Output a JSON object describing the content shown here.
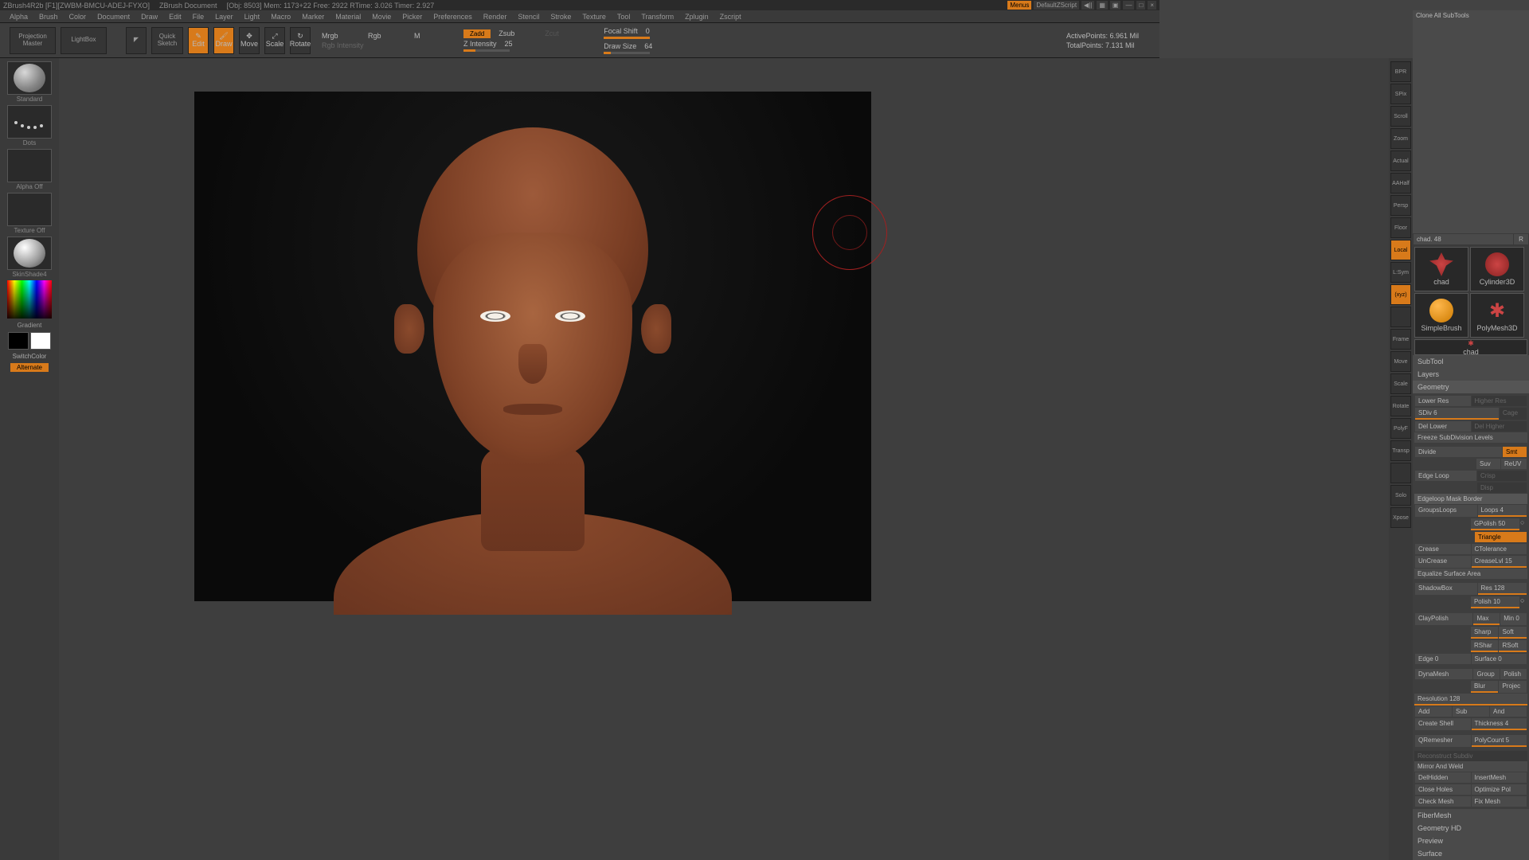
{
  "title": {
    "app": "ZBrush4R2b  [F1][ZWBM-BMCU-ADEJ-FYXO]",
    "doc": "ZBrush Document",
    "obj": "[Obj: 8503] Mem: 1173+22  Free: 2922  RTime: 3.026  Timer: 2.927",
    "menus": "Menus",
    "script": "DefaultZScript"
  },
  "menu": [
    "Alpha",
    "Brush",
    "Color",
    "Document",
    "Draw",
    "Edit",
    "File",
    "Layer",
    "Light",
    "Macro",
    "Marker",
    "Material",
    "Movie",
    "Picker",
    "Preferences",
    "Render",
    "Stencil",
    "Stroke",
    "Texture",
    "Tool",
    "Transform",
    "Zplugin",
    "Zscript"
  ],
  "toolbar": {
    "projection": "Projection Master",
    "lightbox": "LightBox",
    "quicksketch": "Quick Sketch",
    "edit": "Edit",
    "draw": "Draw",
    "move": "Move",
    "scale": "Scale",
    "rotate": "Rotate",
    "mrgb": "Mrgb",
    "rgb": "Rgb",
    "m": "M",
    "rgbint": "Rgb Intensity",
    "zadd": "Zadd",
    "zsub": "Zsub",
    "zcut": "Zcut",
    "zint": "Z Intensity",
    "zintv": "25",
    "focal": "Focal Shift",
    "focalv": "0",
    "dsize": "Draw Size",
    "dsizev": "64",
    "apts": "ActivePoints: 6.961 Mil",
    "tpts": "TotalPoints: 7.131 Mil"
  },
  "left": {
    "brush": "Standard",
    "stroke": "Dots",
    "alpha": "Alpha Off",
    "texture": "Texture Off",
    "material": "SkinShade4",
    "gradient": "Gradient",
    "switchcolor": "SwitchColor",
    "alternate": "Alternate"
  },
  "rt": [
    "BPR",
    "SPix",
    "Scroll",
    "Zoom",
    "Actual",
    "AAHalf",
    "Persp",
    "Floor",
    "Local",
    "L:Sym",
    "(xyz)",
    "",
    "Frame",
    "Move",
    "Scale",
    "Rotate",
    "PolyF",
    "Transp",
    "",
    "Solo",
    "Xpose"
  ],
  "rtOrange": [
    8,
    10
  ],
  "rp": {
    "clone": "Clone All SubTools",
    "chad": "chad. 48",
    "r": "R",
    "thumbs": [
      {
        "lbl": "chad",
        "obj": "figure"
      },
      {
        "lbl": "Cylinder3D",
        "obj": "cyl"
      },
      {
        "lbl": "SimpleBrush",
        "obj": "brush"
      },
      {
        "lbl": "PolyMesh3D",
        "obj": "star"
      }
    ],
    "thumbchad": "chad",
    "subtool": "SubTool",
    "layers": "Layers",
    "geometry": "Geometry",
    "lowerres": "Lower Res",
    "higherres": "Higher Res",
    "sdiv": "SDiv 6",
    "cage": "Cage",
    "dellower": "Del Lower",
    "delhigher": "Del Higher",
    "freeze": "Freeze SubDivision Levels",
    "divide": "Divide",
    "smt": "Smt",
    "suv": "Suv",
    "reuv": "ReUV",
    "crisp": "Crisp",
    "edgeloop": "Edge Loop",
    "disp": "Disp",
    "edgemask": "Edgeloop Mask Border",
    "gloops": "GroupsLoops",
    "loops": "Loops 4",
    "gpolish": "GPolish 50",
    "triangle": "Triangle",
    "crease": "Crease",
    "ctol": "CTolerance",
    "uncrease": "UnCrease",
    "creaselvl": "CreaseLvl 15",
    "eqsurf": "Equalize Surface Area",
    "shadowbox": "ShadowBox",
    "res": "Res 128",
    "polish": "Polish 10",
    "claypolish": "ClayPolish",
    "max": "Max",
    "min": "Min 0",
    "sharp": "Sharp",
    "soft": "Soft",
    "rshar": "RShar",
    "rsoft": "RSoft",
    "edge": "Edge 0",
    "surface": "Surface 0",
    "dynamesh": "DynaMesh",
    "group": "Group",
    "polishd": "Polish",
    "blur": "Blur",
    "project": "Projec",
    "resolution": "Resolution 128",
    "add": "Add",
    "sub": "Sub",
    "and": "And",
    "cshell": "Create Shell",
    "thick": "Thickness 4",
    "qremesh": "QRemesher",
    "polycount": "PolyCount 5",
    "recon": "Reconstruct Subdiv",
    "mirror": "Mirror And Weld",
    "delhidden": "DelHidden",
    "insertmesh": "InsertMesh",
    "closeh": "Close Holes",
    "optpoly": "Optimize Pol",
    "checkmesh": "Check Mesh",
    "fixmesh": "Fix Mesh",
    "fibermesh": "FiberMesh",
    "geohd": "Geometry HD",
    "preview": "Preview",
    "surfacep": "Surface"
  }
}
